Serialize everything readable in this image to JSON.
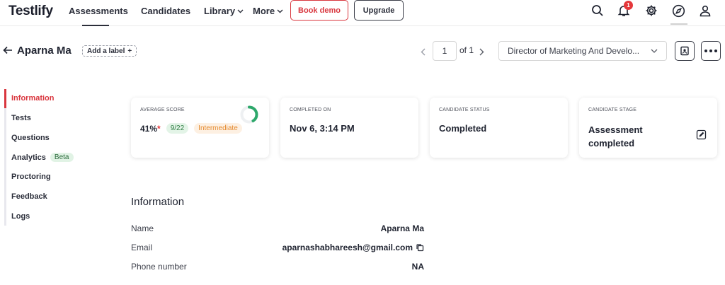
{
  "brand": {
    "logo_text": "Testlify",
    "logo_subtext": ""
  },
  "nav": {
    "assessments": "Assessments",
    "candidates": "Candidates",
    "library": "Library",
    "more": "More",
    "book_demo": "Book demo",
    "upgrade": "Upgrade",
    "notification_count": "1"
  },
  "header": {
    "candidate_name": "Aparna Ma",
    "add_label": "Add a label",
    "pager_current": "1",
    "pager_total": "of 1",
    "role": "Director of Marketing And Develo..."
  },
  "sidebar": {
    "items": [
      {
        "label": "Information"
      },
      {
        "label": "Tests"
      },
      {
        "label": "Questions"
      },
      {
        "label": "Analytics",
        "badge": "Beta"
      },
      {
        "label": "Proctoring"
      },
      {
        "label": "Feedback"
      },
      {
        "label": "Logs"
      }
    ]
  },
  "cards": {
    "score": {
      "title": "AVERAGE SCORE",
      "value": "41%",
      "asterisk": "*",
      "fraction": "9/22",
      "level": "Intermediate",
      "ring_fraction": 0.41
    },
    "completed_on": {
      "title": "COMPLETED ON",
      "value": "Nov 6, 3:14 PM"
    },
    "status": {
      "title": "CANDIDATE STATUS",
      "value": "Completed"
    },
    "stage": {
      "title": "CANDIDATE STAGE",
      "value": "Assessment completed"
    }
  },
  "information": {
    "title": "Information",
    "fields": [
      {
        "label": "Name",
        "value": "Aparna Ma"
      },
      {
        "label": "Email",
        "value": "aparnashabhareesh@gmail.com"
      },
      {
        "label": "Phone number",
        "value": "NA"
      }
    ]
  },
  "colors": {
    "accent": "#d9363e",
    "success": "#2e7d43",
    "warning": "#e58a2e"
  }
}
